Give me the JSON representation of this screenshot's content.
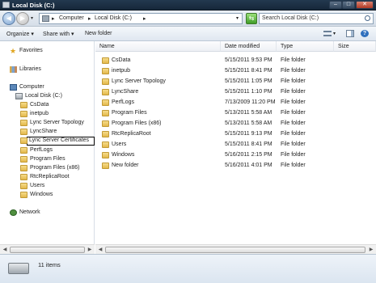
{
  "window": {
    "title": "Local Disk (C:)"
  },
  "address": {
    "crumbs": [
      "Computer",
      "Local Disk (C:)"
    ],
    "separator": "▸"
  },
  "search": {
    "placeholder": "Search Local Disk (C:)"
  },
  "toolbar": {
    "organize": "Organize",
    "share_with": "Share with",
    "new_folder": "New folder"
  },
  "sidebar": {
    "favorites": "Favorites",
    "libraries": "Libraries",
    "computer": "Computer",
    "local_disk": "Local Disk (C:)",
    "folders": [
      "CsData",
      "inetpub",
      "Lync Server Topology",
      "LyncShare",
      "Lync Server Certificates",
      "PerfLogs",
      "Program Files",
      "Program Files (x86)",
      "RtcReplicaRoot",
      "Users",
      "Windows"
    ],
    "network": "Network"
  },
  "columns": {
    "name": "Name",
    "date_modified": "Date modified",
    "type": "Type",
    "size": "Size"
  },
  "files": [
    {
      "name": "CsData",
      "date": "5/15/2011 9:53 PM",
      "type": "File folder"
    },
    {
      "name": "inetpub",
      "date": "5/15/2011 8:41 PM",
      "type": "File folder"
    },
    {
      "name": "Lync Server Topology",
      "date": "5/15/2011 1:05 PM",
      "type": "File folder"
    },
    {
      "name": "LyncShare",
      "date": "5/15/2011 1:10 PM",
      "type": "File folder"
    },
    {
      "name": "PerfLogs",
      "date": "7/13/2009 11:20 PM",
      "type": "File folder"
    },
    {
      "name": "Program Files",
      "date": "5/13/2011 5:58 AM",
      "type": "File folder"
    },
    {
      "name": "Program Files (x86)",
      "date": "5/13/2011 5:58 AM",
      "type": "File folder"
    },
    {
      "name": "RtcReplicaRoot",
      "date": "5/15/2011 9:13 PM",
      "type": "File folder"
    },
    {
      "name": "Users",
      "date": "5/15/2011 8:41 PM",
      "type": "File folder"
    },
    {
      "name": "Windows",
      "date": "5/16/2011 2:15 PM",
      "type": "File folder"
    },
    {
      "name": "New folder",
      "date": "5/16/2011 4:01 PM",
      "type": "File folder"
    }
  ],
  "status": {
    "item_count": "11 items"
  },
  "icons": {
    "window": "drive-icon",
    "back": "back-arrow-icon",
    "forward": "forward-arrow-icon",
    "refresh": "refresh-icon",
    "search": "search-icon",
    "folder": "folder-icon",
    "star": "star-icon",
    "library": "library-icon",
    "computer": "computer-icon",
    "network": "network-icon"
  }
}
